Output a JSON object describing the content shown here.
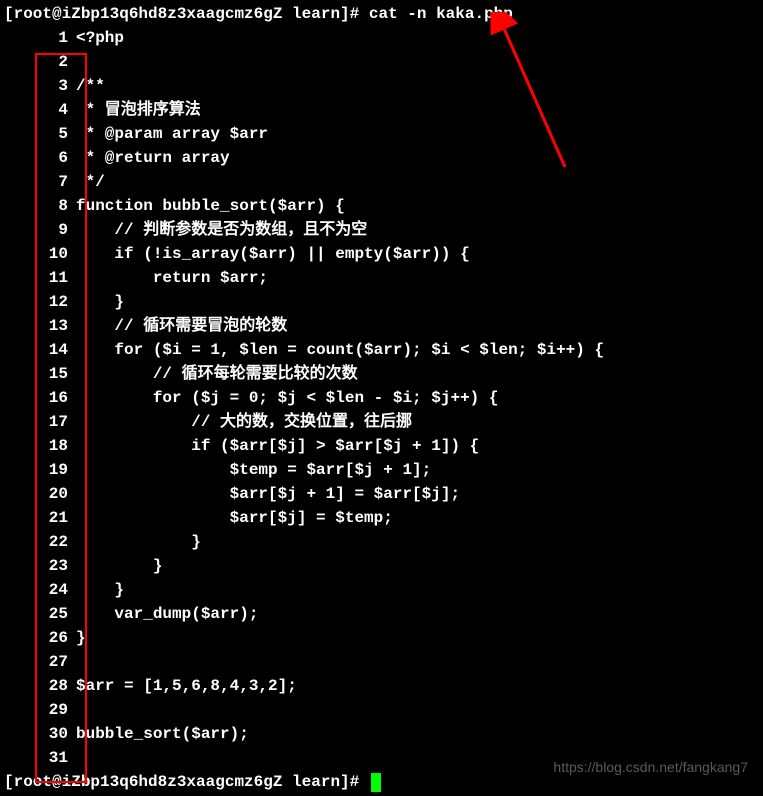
{
  "prompt_top": "[root@iZbp13q6hd8z3xaagcmz6gZ learn]# cat -n kaka.php",
  "prompt_bottom": "[root@iZbp13q6hd8z3xaagcmz6gZ learn]# ",
  "watermark": "https://blog.csdn.net/fangkang7",
  "lines": [
    {
      "n": "1",
      "c": "<?php"
    },
    {
      "n": "2",
      "c": ""
    },
    {
      "n": "3",
      "c": "/**"
    },
    {
      "n": "4",
      "c": " * 冒泡排序算法"
    },
    {
      "n": "5",
      "c": " * @param array $arr"
    },
    {
      "n": "6",
      "c": " * @return array"
    },
    {
      "n": "7",
      "c": " */"
    },
    {
      "n": "8",
      "c": "function bubble_sort($arr) {"
    },
    {
      "n": "9",
      "c": "    // 判断参数是否为数组，且不为空"
    },
    {
      "n": "10",
      "c": "    if (!is_array($arr) || empty($arr)) {"
    },
    {
      "n": "11",
      "c": "        return $arr;"
    },
    {
      "n": "12",
      "c": "    }"
    },
    {
      "n": "13",
      "c": "    // 循环需要冒泡的轮数"
    },
    {
      "n": "14",
      "c": "    for ($i = 1, $len = count($arr); $i < $len; $i++) {"
    },
    {
      "n": "15",
      "c": "        // 循环每轮需要比较的次数"
    },
    {
      "n": "16",
      "c": "        for ($j = 0; $j < $len - $i; $j++) {"
    },
    {
      "n": "17",
      "c": "            // 大的数，交换位置，往后挪"
    },
    {
      "n": "18",
      "c": "            if ($arr[$j] > $arr[$j + 1]) {"
    },
    {
      "n": "19",
      "c": "                $temp = $arr[$j + 1];"
    },
    {
      "n": "20",
      "c": "                $arr[$j + 1] = $arr[$j];"
    },
    {
      "n": "21",
      "c": "                $arr[$j] = $temp;"
    },
    {
      "n": "22",
      "c": "            }"
    },
    {
      "n": "23",
      "c": "        }"
    },
    {
      "n": "24",
      "c": "    }"
    },
    {
      "n": "25",
      "c": "    var_dump($arr);"
    },
    {
      "n": "26",
      "c": "}"
    },
    {
      "n": "27",
      "c": ""
    },
    {
      "n": "28",
      "c": "$arr = [1,5,6,8,4,3,2];"
    },
    {
      "n": "29",
      "c": ""
    },
    {
      "n": "30",
      "c": "bubble_sort($arr);"
    },
    {
      "n": "31",
      "c": ""
    }
  ]
}
